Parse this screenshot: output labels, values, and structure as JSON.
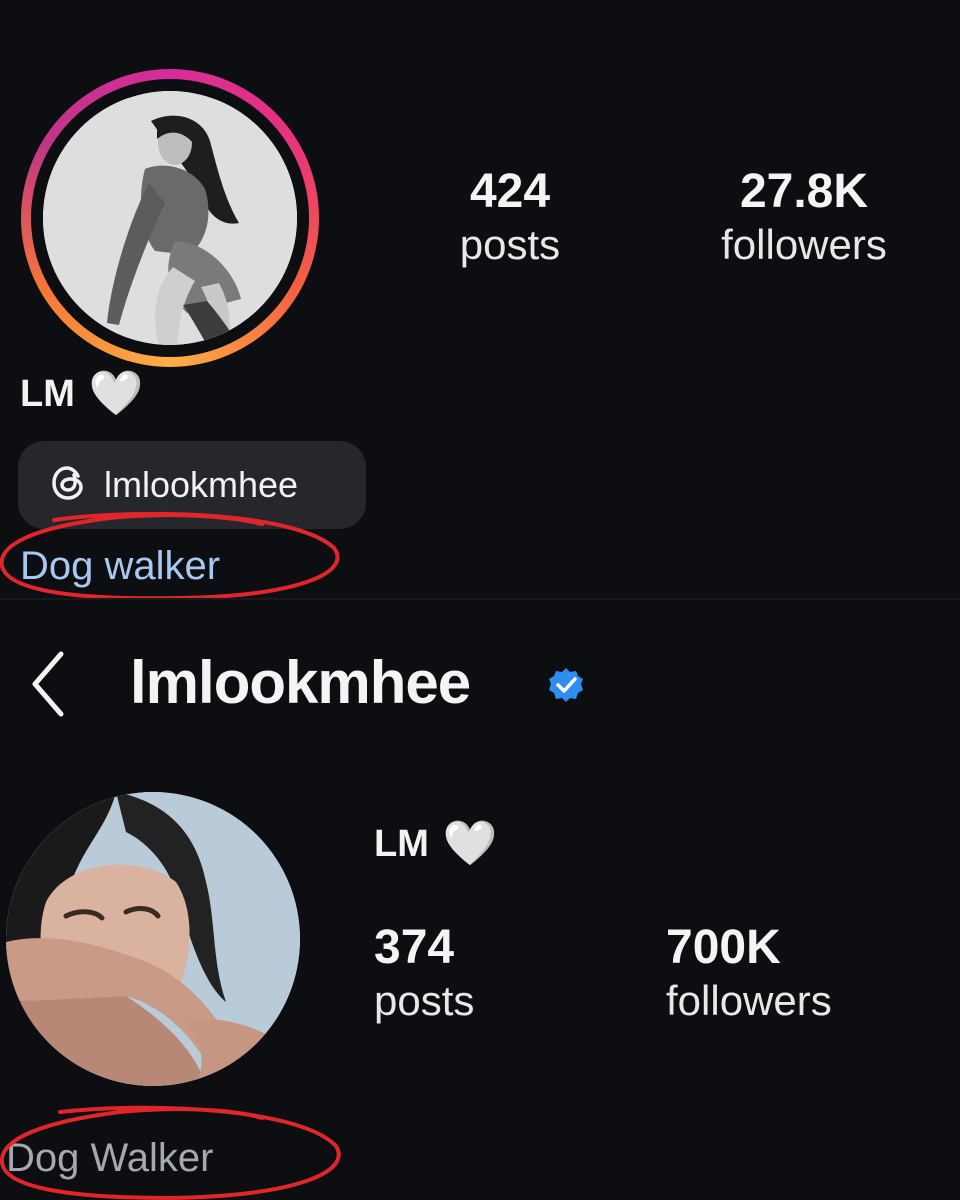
{
  "top_profile": {
    "display_name": "LM",
    "heart_glyph": "🤍",
    "stats": [
      {
        "value": "424",
        "label": "posts"
      },
      {
        "value": "27.8K",
        "label": "followers"
      }
    ],
    "threads_handle": "lmlookmhee",
    "bio": "Dog walker",
    "story_ring_colors": [
      "#d62d9a",
      "#f56040",
      "#fcaf45"
    ],
    "annotation_color": "#e0262a"
  },
  "bottom_profile": {
    "username": "lmlookmhee",
    "display_name": "LM",
    "heart_glyph": "🤍",
    "stats": [
      {
        "value": "374",
        "label": "posts"
      },
      {
        "value": "700K",
        "label": "followers"
      }
    ],
    "bio": "Dog Walker",
    "verified_color": "#2f8cf0",
    "icons": [
      "chevron-left-icon",
      "verified-badge-icon",
      "threads-icon",
      "heart-icon"
    ]
  }
}
